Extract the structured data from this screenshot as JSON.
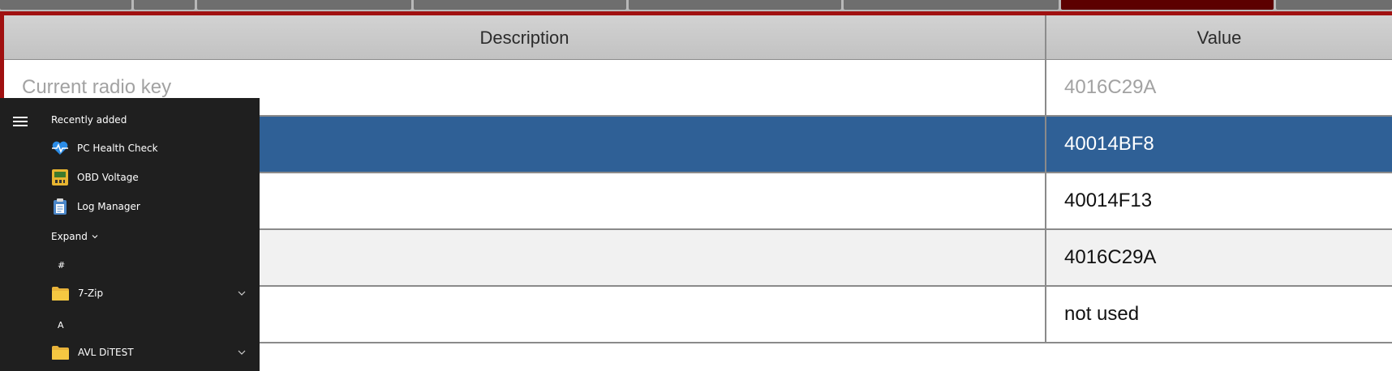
{
  "table": {
    "columns": {
      "description": "Description",
      "value": "Value"
    },
    "rows": [
      {
        "description": "Current radio key",
        "value": "4016C29A",
        "state": "dim"
      },
      {
        "description": "",
        "value": "40014BF8",
        "state": "selected"
      },
      {
        "description": "",
        "value": "40014F13",
        "state": "normal"
      },
      {
        "description": "",
        "value": "4016C29A",
        "state": "alt"
      },
      {
        "description": "",
        "value": "not used",
        "state": "normal"
      }
    ]
  },
  "colors": {
    "frame_accent": "#a01010",
    "selected_row": "#2f6096",
    "start_menu_bg": "#1f1f1f"
  },
  "start_menu": {
    "recently_added_heading": "Recently added",
    "recent_apps": [
      {
        "label": "PC Health Check",
        "icon": "heart-pulse-icon"
      },
      {
        "label": "OBD Voltage",
        "icon": "voltage-meter-icon"
      },
      {
        "label": "Log Manager",
        "icon": "clipboard-icon"
      }
    ],
    "expand_label": "Expand",
    "groups": [
      {
        "letter": "#",
        "folder": "7-Zip",
        "icon": "folder-icon"
      },
      {
        "letter": "A",
        "folder": "AVL DiTEST",
        "icon": "folder-icon"
      }
    ]
  }
}
